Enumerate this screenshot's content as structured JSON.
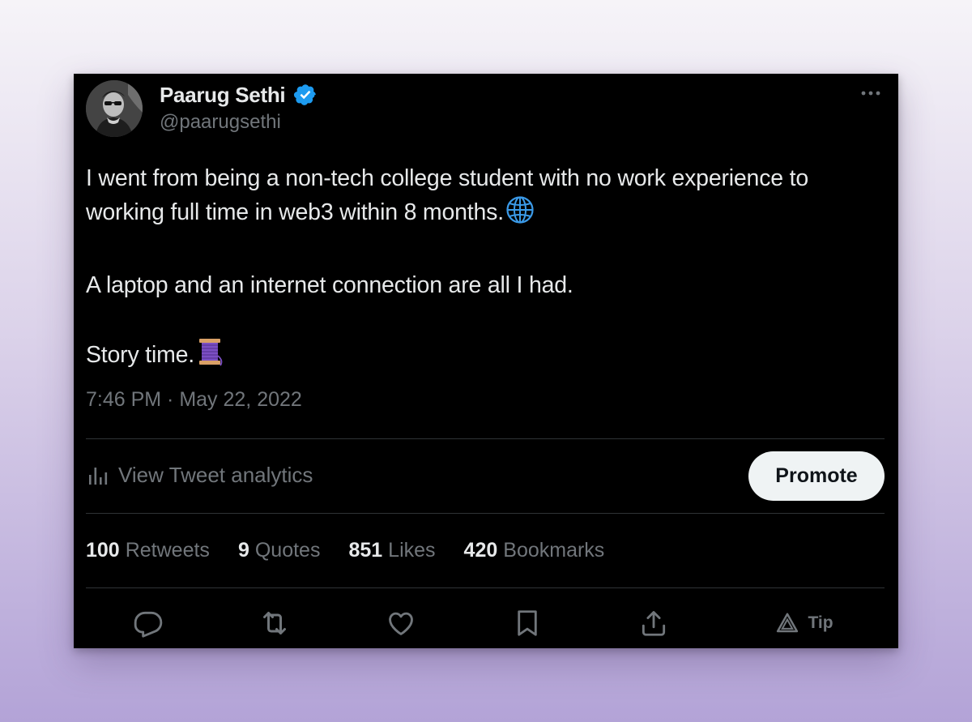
{
  "author": {
    "display_name": "Paarug Sethi",
    "handle": "@paarugsethi",
    "verified": true
  },
  "tweet": {
    "line1": "I went from being a non-tech college student with no work experience to",
    "line2": "working full time in web3 within 8 months.",
    "line3": "A laptop and an internet connection are all I had.",
    "line4": "Story time.",
    "emoji1": "globe-emoji",
    "emoji2": "thread-spool-emoji"
  },
  "timestamp": "7:46 PM · May 22, 2022",
  "analytics_label": "View Tweet analytics",
  "promote_label": "Promote",
  "stats": {
    "retweets_count": "100",
    "retweets_label": "Retweets",
    "quotes_count": "9",
    "quotes_label": "Quotes",
    "likes_count": "851",
    "likes_label": "Likes",
    "bookmarks_count": "420",
    "bookmarks_label": "Bookmarks"
  },
  "actions": {
    "tip_label": "Tip"
  },
  "colors": {
    "card_bg": "#000000",
    "text_primary": "#e7e9ea",
    "text_secondary": "#71767b",
    "divider": "#2f3336",
    "verified_blue": "#1d9bf0",
    "promote_bg": "#eff3f4"
  }
}
